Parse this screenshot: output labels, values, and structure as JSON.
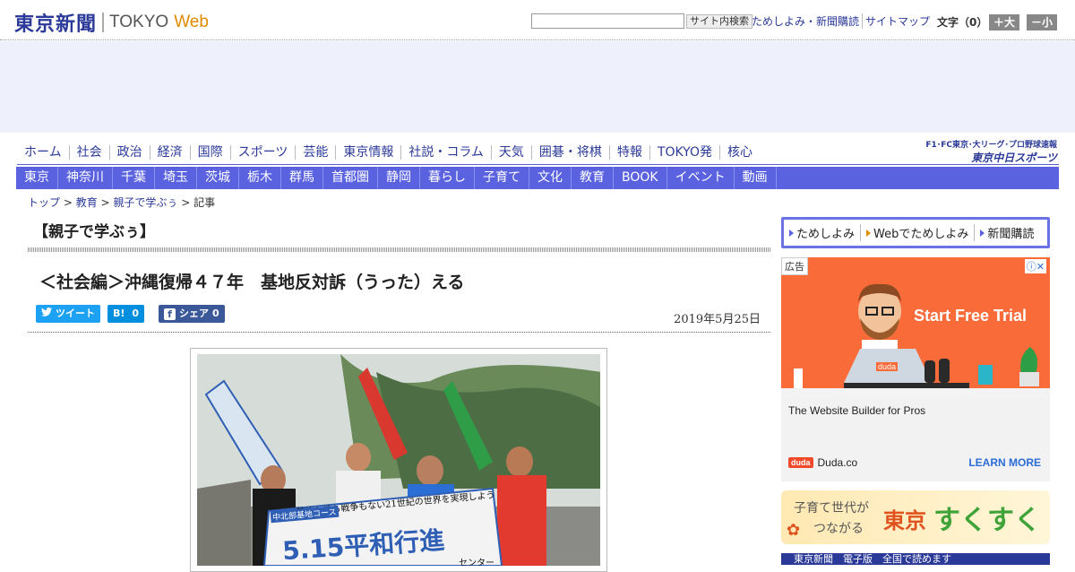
{
  "header": {
    "logo_ja": "東京新聞",
    "logo_en1": "TOKYO",
    "logo_en2": "Web",
    "search_placeholder": "",
    "search_button": "サイト内検索",
    "links": [
      "ためしよみ・新聞購読",
      "サイトマップ"
    ],
    "font_size_label": "文字（0）",
    "font_larger": "＋大",
    "font_smaller": "－小"
  },
  "nav_primary": [
    "ホーム",
    "社会",
    "政治",
    "経済",
    "国際",
    "スポーツ",
    "芸能",
    "東京情報",
    "社説・コラム",
    "天気",
    "囲碁・将棋",
    "特報",
    "TOKYO発",
    "核心"
  ],
  "chunichi": {
    "line1": "F1･FC東京･大リーグ･プロ野球速報",
    "line2": "東京中日スポーツ"
  },
  "nav_secondary": [
    "東京",
    "神奈川",
    "千葉",
    "埼玉",
    "茨城",
    "栃木",
    "群馬",
    "首都圏",
    "静岡",
    "暮らし",
    "子育て",
    "文化",
    "教育",
    "BOOK",
    "イベント",
    "動画"
  ],
  "breadcrumb": {
    "items": [
      "トップ",
      "教育",
      "親子で学ぶぅ"
    ],
    "current": "記事"
  },
  "article": {
    "category_title": "【親子で学ぶぅ】",
    "title": "＜社会編＞沖縄復帰４７年　基地反対訴（うった）える",
    "date": "2019年5月25日",
    "share": {
      "tweet": "ツイート",
      "hatena_count": "0",
      "facebook": "シェア",
      "facebook_count": "0"
    },
    "photo": {
      "banner_main": "5.15平和行進",
      "banner_sub": "基地も核も戦争もない21世紀の世界を実現しよう",
      "banner_left": "中北部基地コース",
      "banner_right": "センター"
    }
  },
  "sidebar": {
    "links": [
      "ためしよみ",
      "Webでためしよみ",
      "新聞購読"
    ],
    "ad": {
      "label": "広告",
      "headline": "Start Free Trial",
      "description": "The Website Builder for Pros",
      "brand_tag": "duda",
      "brand": "Duda.co",
      "cta": "LEARN MORE",
      "info": "ⓘ✕",
      "laptop_logo": "duda"
    },
    "sukusuku": {
      "line1": "子育て世代が",
      "line2": "つながる",
      "brand1": "東京",
      "brand2": "すくすく"
    },
    "bottom_banner": "東京新聞　電子版　全国で読めます"
  },
  "colors": {
    "brand_blue": "#2b3a98",
    "nav_purple": "#5a62e0",
    "accent_orange": "#e08a00",
    "ad_orange": "#fa6b3a"
  }
}
